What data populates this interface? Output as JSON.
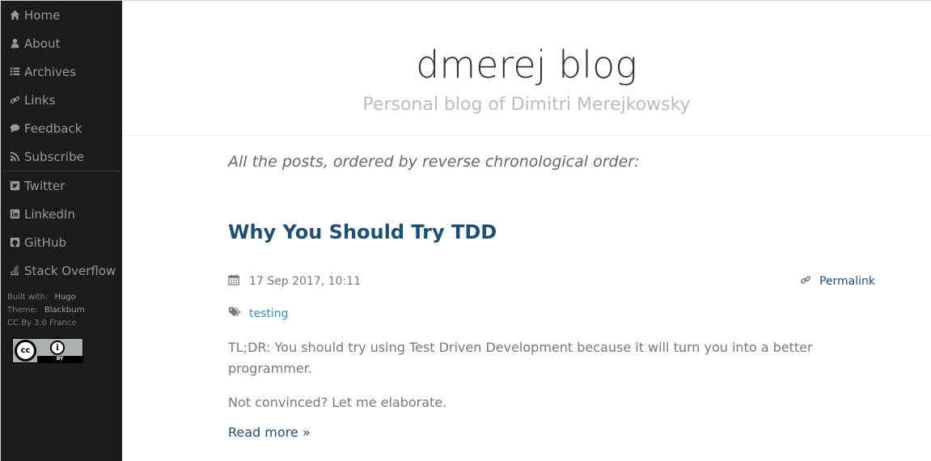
{
  "sidebar": {
    "nav": [
      {
        "label": "Home",
        "icon": "home-icon"
      },
      {
        "label": "About",
        "icon": "user-icon"
      },
      {
        "label": "Archives",
        "icon": "list-icon"
      },
      {
        "label": "Links",
        "icon": "link-icon"
      },
      {
        "label": "Feedback",
        "icon": "comment-icon"
      },
      {
        "label": "Subscribe",
        "icon": "rss-icon"
      }
    ],
    "social": [
      {
        "label": "Twitter",
        "icon": "twitter-icon"
      },
      {
        "label": "LinkedIn",
        "icon": "linkedin-icon"
      },
      {
        "label": "GitHub",
        "icon": "github-icon"
      },
      {
        "label": "Stack Overflow",
        "icon": "stack-overflow-icon"
      }
    ],
    "meta": {
      "built_with_label": "Built with:",
      "built_with_value": "Hugo",
      "theme_label": "Theme:",
      "theme_value": "Blackburn",
      "license": "CC By 3.0 France"
    },
    "badge": {
      "cc": "cc",
      "by": "BY"
    }
  },
  "header": {
    "title": "dmerej blog",
    "subtitle": "Personal blog of Dimitri Merejkowsky"
  },
  "main": {
    "intro": "All the posts, ordered by reverse chronological order:",
    "post": {
      "title": "Why You Should Try TDD",
      "date": "17 Sep 2017, 10:11",
      "permalink": "Permalink",
      "tag": "testing",
      "summary": "TL;DR: You should try using Test Driven Development because it will turn you into a better programmer.",
      "summary2": "Not convinced? Let me elaborate.",
      "read_more": "Read more »"
    }
  },
  "colors": {
    "sidebar_bg": "#1c1c1c",
    "post_title": "#1f4e75",
    "tag_link": "#3b8dbd"
  }
}
